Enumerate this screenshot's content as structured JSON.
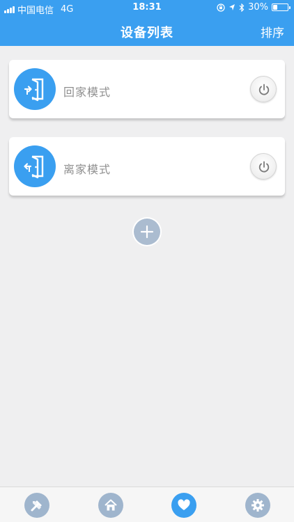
{
  "status_bar": {
    "carrier": "中国电信",
    "network": "4G",
    "time": "18:31",
    "battery": "30%",
    "battery_level": 0.3
  },
  "header": {
    "title": "设备列表",
    "sort_label": "排序"
  },
  "modes": [
    {
      "label": "回家模式",
      "icon": "door-enter-icon"
    },
    {
      "label": "离家模式",
      "icon": "door-exit-icon"
    }
  ],
  "tabs": [
    {
      "icon": "tools-icon",
      "active": false
    },
    {
      "icon": "home-icon",
      "active": false
    },
    {
      "icon": "heart-icon",
      "active": true
    },
    {
      "icon": "gear-icon",
      "active": false
    }
  ],
  "colors": {
    "accent": "#3a9ff0",
    "inactive_tab": "#9fb5cd",
    "add_button": "#abbcd0",
    "background": "#efeff0"
  }
}
